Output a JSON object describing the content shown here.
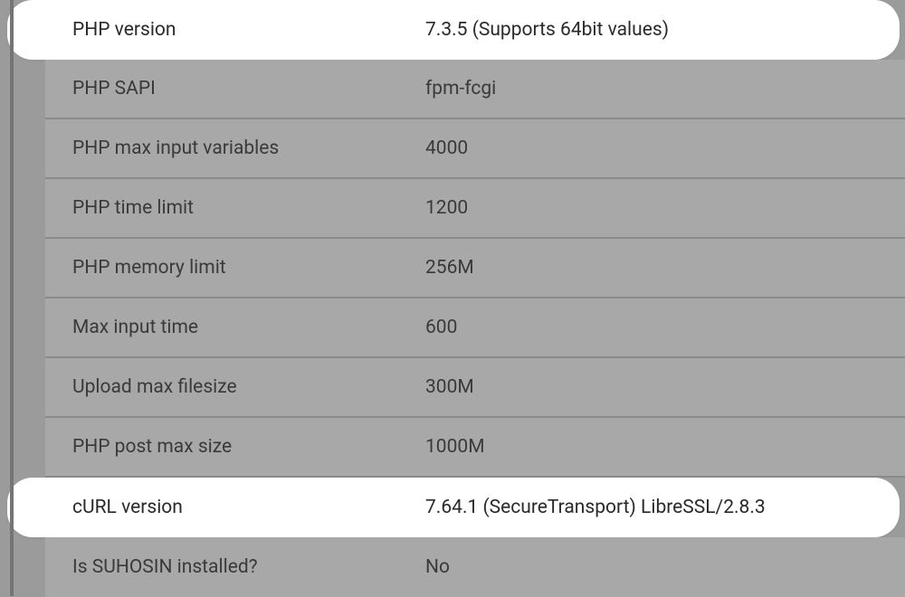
{
  "rows": [
    {
      "label": "PHP version",
      "value": "7.3.5 (Supports 64bit values)",
      "highlight": true
    },
    {
      "label": "PHP SAPI",
      "value": "fpm-fcgi",
      "highlight": false
    },
    {
      "label": "PHP max input variables",
      "value": "4000",
      "highlight": false
    },
    {
      "label": "PHP time limit",
      "value": "1200",
      "highlight": false
    },
    {
      "label": "PHP memory limit",
      "value": "256M",
      "highlight": false
    },
    {
      "label": "Max input time",
      "value": "600",
      "highlight": false
    },
    {
      "label": "Upload max filesize",
      "value": "300M",
      "highlight": false
    },
    {
      "label": "PHP post max size",
      "value": "1000M",
      "highlight": false
    },
    {
      "label": "cURL version",
      "value": "7.64.1 (SecureTransport) LibreSSL/2.8.3",
      "highlight": true
    },
    {
      "label": "Is SUHOSIN installed?",
      "value": "No",
      "highlight": false
    }
  ]
}
